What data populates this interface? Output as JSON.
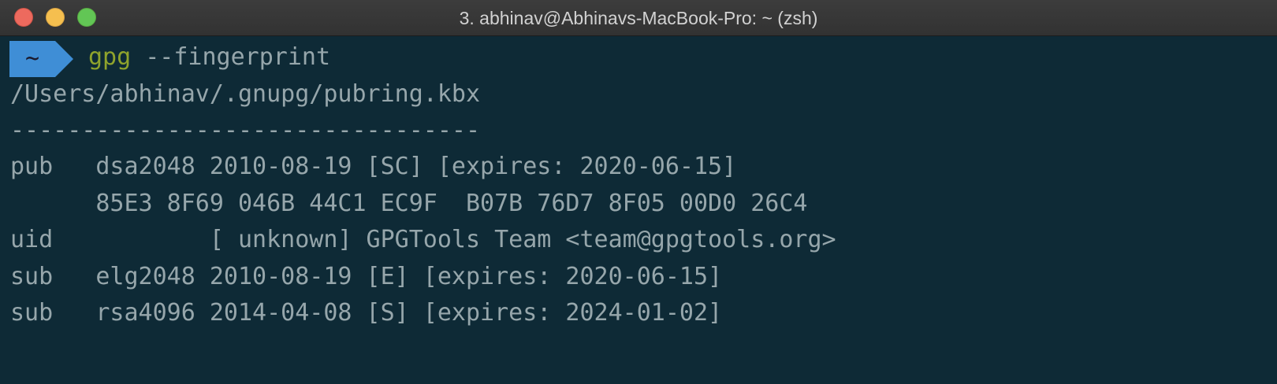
{
  "window": {
    "title": "3. abhinav@Abhinavs-MacBook-Pro: ~ (zsh)"
  },
  "prompt": {
    "dir": "~",
    "command": "gpg",
    "args": " --fingerprint"
  },
  "output": {
    "keyring_path": "/Users/abhinav/.gnupg/pubring.kbx",
    "separator": "---------------------------------",
    "lines": [
      "pub   dsa2048 2010-08-19 [SC] [expires: 2020-06-15]",
      "      85E3 8F69 046B 44C1 EC9F  B07B 76D7 8F05 00D0 26C4",
      "uid           [ unknown] GPGTools Team <team@gpgtools.org>",
      "sub   elg2048 2010-08-19 [E] [expires: 2020-06-15]",
      "sub   rsa4096 2014-04-08 [S] [expires: 2024-01-02]"
    ]
  },
  "colors": {
    "background": "#0e2a36",
    "text": "#96a6ab",
    "command": "#8fa32c",
    "prompt_badge": "#3f8ed6"
  }
}
